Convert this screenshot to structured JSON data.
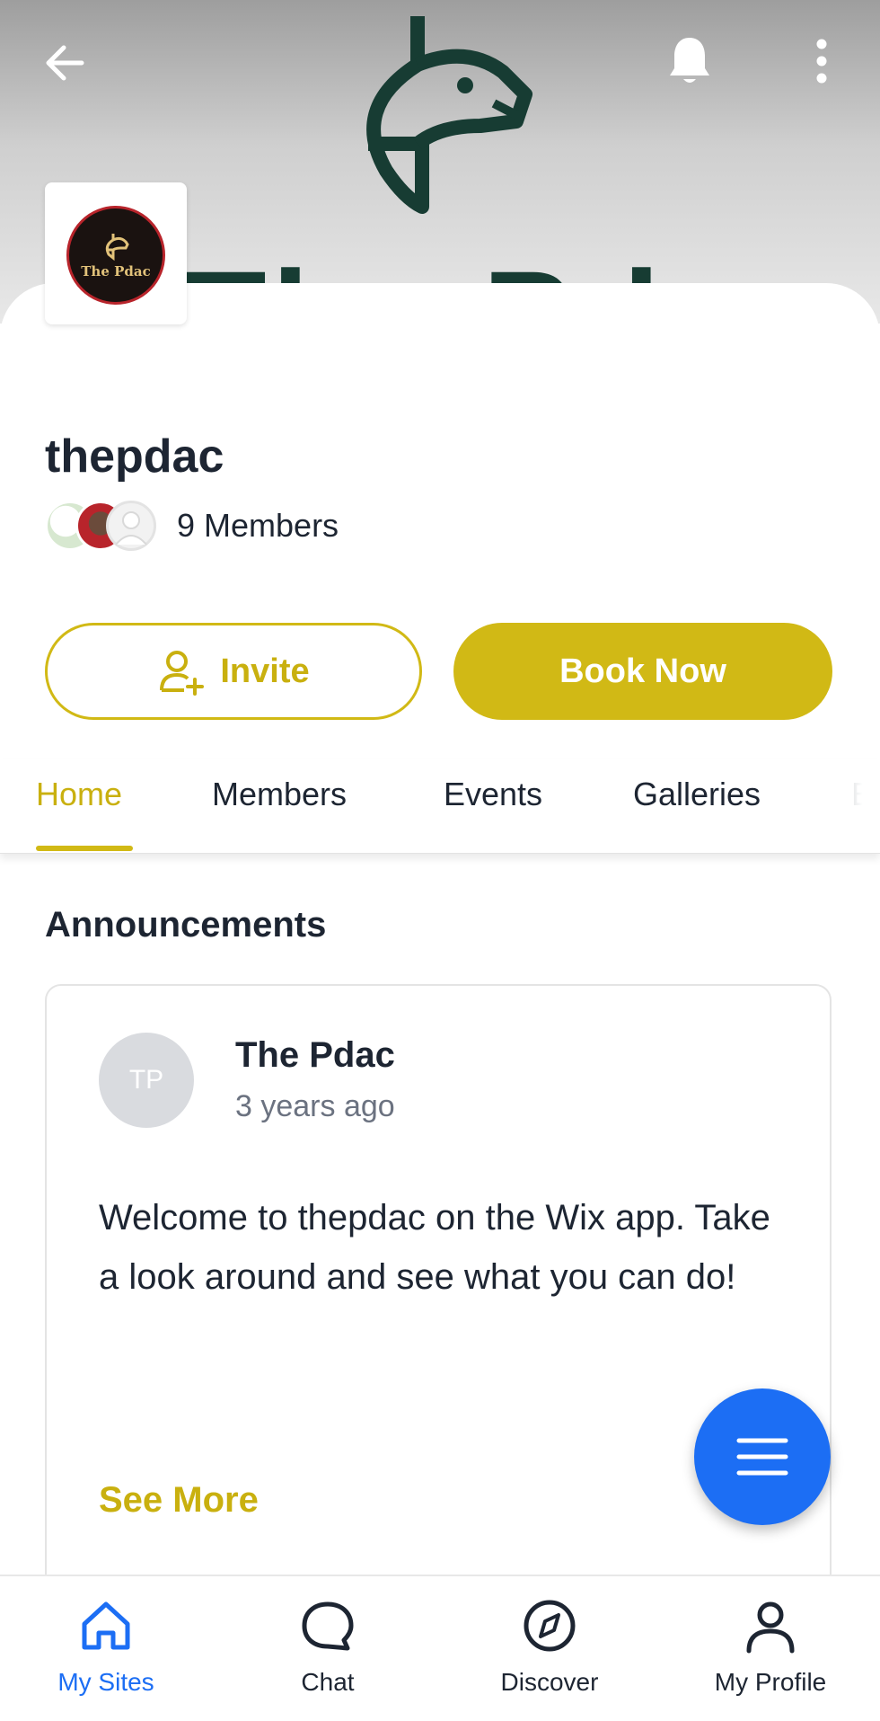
{
  "header": {
    "back_icon": "arrow-left-icon",
    "notifications_icon": "bell-icon",
    "more_icon": "vertical-dots-icon",
    "cover_text": "The Pdac"
  },
  "site": {
    "logo_text": "The Pdac",
    "name": "thepdac",
    "members_label": "9 Members"
  },
  "actions": {
    "invite_label": "Invite",
    "book_label": "Book Now"
  },
  "tabs": [
    {
      "label": "Home",
      "active": true
    },
    {
      "label": "Members",
      "active": false
    },
    {
      "label": "Events",
      "active": false
    },
    {
      "label": "Galleries",
      "active": false
    },
    {
      "label": "E",
      "active": false
    }
  ],
  "announcements": {
    "title": "Announcements",
    "post": {
      "initials": "TP",
      "author": "The Pdac",
      "time": "3 years ago",
      "body": "Welcome to thepdac on the Wix app. Take a look around and see what you can do!",
      "see_more": "See More"
    }
  },
  "fab_icon": "menu-icon",
  "bottom_nav": [
    {
      "label": "My Sites",
      "icon": "home-icon",
      "active": true
    },
    {
      "label": "Chat",
      "icon": "chat-icon",
      "active": false
    },
    {
      "label": "Discover",
      "icon": "compass-icon",
      "active": false
    },
    {
      "label": "My Profile",
      "icon": "person-icon",
      "active": false
    }
  ],
  "colors": {
    "accent": "#d1b915",
    "primary_blue": "#1c6ef4",
    "text": "#1d2532",
    "cover_art": "#173c33"
  }
}
